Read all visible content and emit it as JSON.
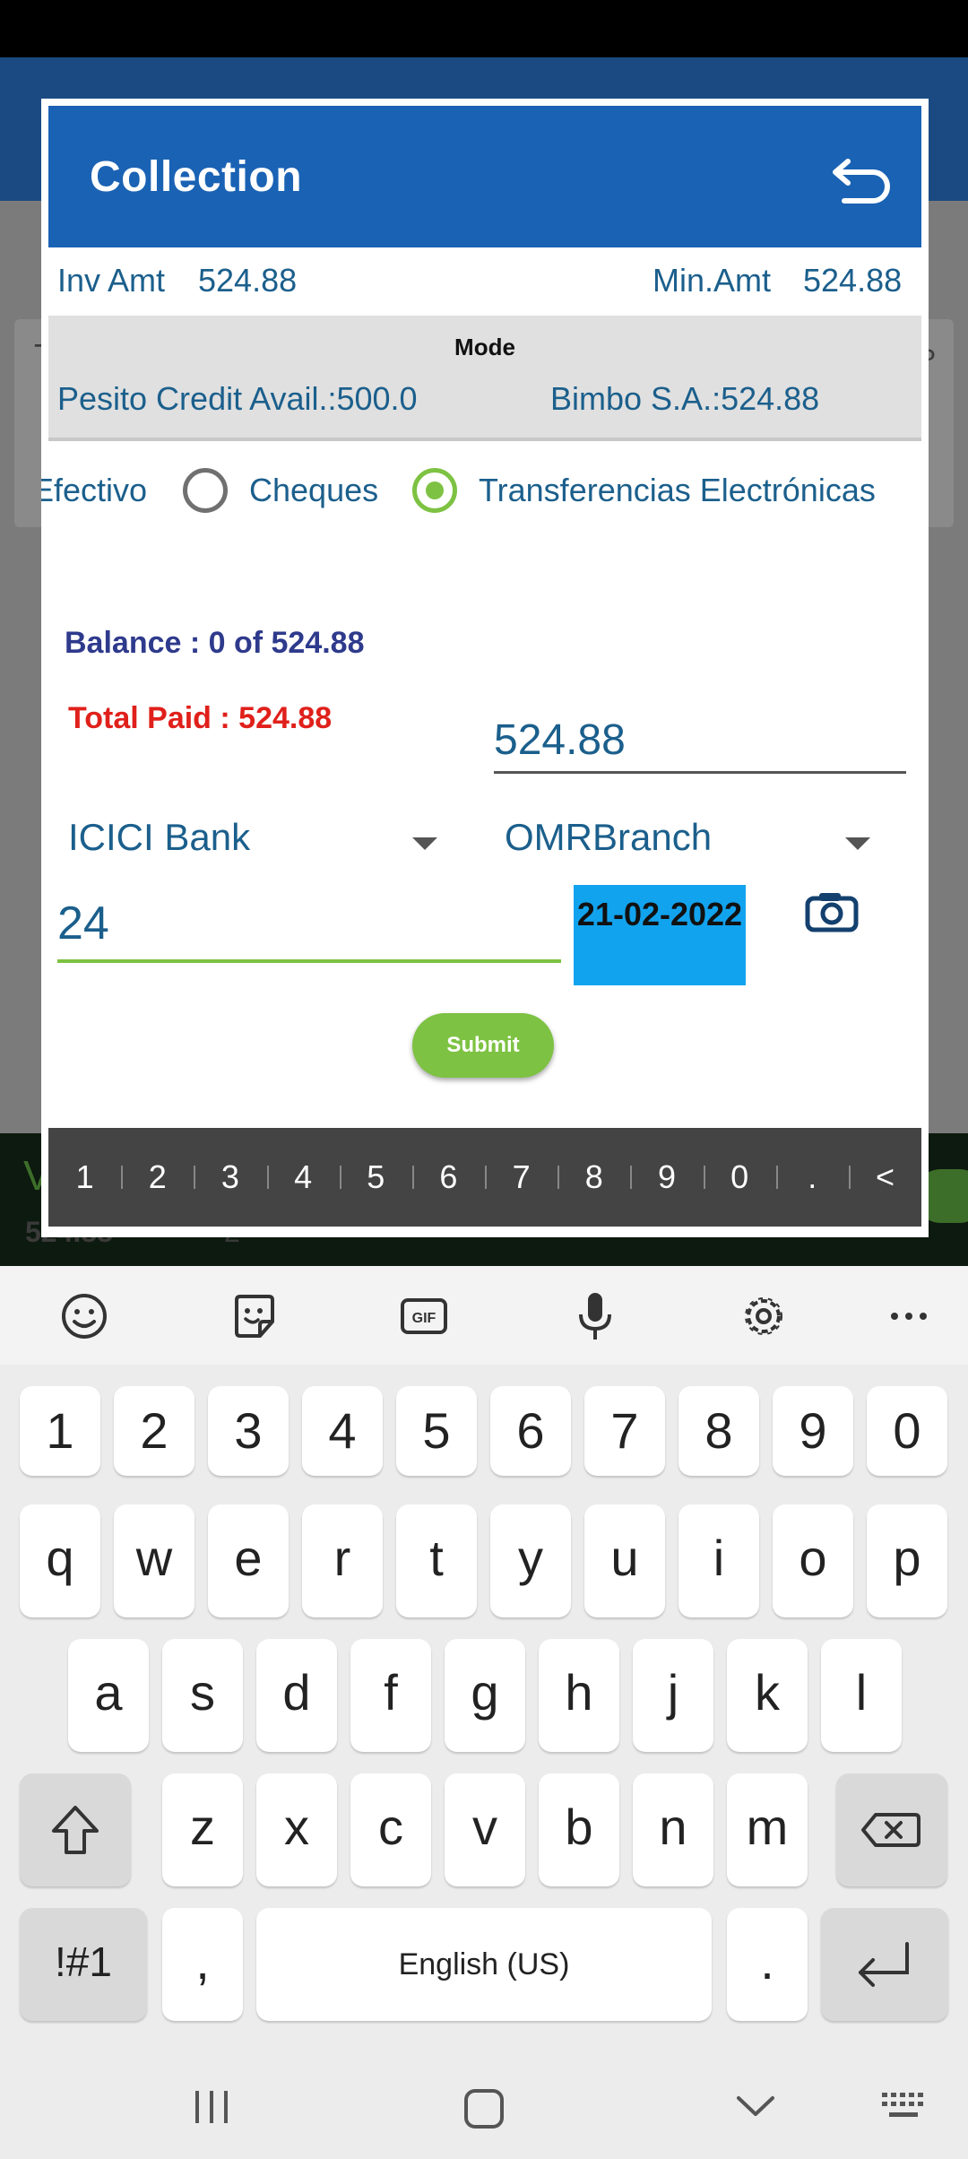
{
  "background": {
    "card_title": "T",
    "card_right": "P",
    "bottom_v": "V",
    "bottom_amount": "524.88",
    "bottom_count": "2"
  },
  "dialog": {
    "title": "Collection",
    "inv_amt_label": "Inv Amt",
    "inv_amt_value": "524.88",
    "min_amt_label": "Min.Amt",
    "min_amt_value": "524.88",
    "mode_title": "Mode",
    "credit_avail": "Pesito Credit Avail.:500.0",
    "bimbo": "Bimbo S.A.:524.88",
    "radio_options": [
      {
        "label": "Efectivo",
        "selected": false
      },
      {
        "label": "Cheques",
        "selected": false
      },
      {
        "label": "Transferencias Electrónicas",
        "selected": true
      }
    ],
    "balance": "Balance : 0 of 524.88",
    "total_paid": "Total Paid : 524.88",
    "amount_value": "524.88",
    "bank": "ICICI Bank",
    "branch": "OMRBranch",
    "reference_value": "24",
    "date": "21-02-2022",
    "submit_label": "Submit",
    "numpad_keys": [
      "1",
      "2",
      "3",
      "4",
      "5",
      "6",
      "7",
      "8",
      "9",
      "0",
      ".",
      "<"
    ]
  },
  "colors": {
    "header_blue": "#1a62b4",
    "accent_green": "#7dc242",
    "date_blue": "#12a3ee",
    "text_blue": "#1b5f8c",
    "total_red": "#e0201b"
  },
  "keyboard": {
    "toolbar_icons": [
      "emoji-icon",
      "sticker-icon",
      "gif-icon",
      "microphone-icon",
      "settings-icon",
      "more-icon"
    ],
    "gif_label": "GIF",
    "row_numbers": [
      "1",
      "2",
      "3",
      "4",
      "5",
      "6",
      "7",
      "8",
      "9",
      "0"
    ],
    "row_top": [
      "q",
      "w",
      "e",
      "r",
      "t",
      "y",
      "u",
      "i",
      "o",
      "p"
    ],
    "row_mid": [
      "a",
      "s",
      "d",
      "f",
      "g",
      "h",
      "j",
      "k",
      "l"
    ],
    "row_bottom": [
      "z",
      "x",
      "c",
      "v",
      "b",
      "n",
      "m"
    ],
    "symbols_label": "!#1",
    "comma": ",",
    "space_label": "English (US)",
    "period": "."
  }
}
